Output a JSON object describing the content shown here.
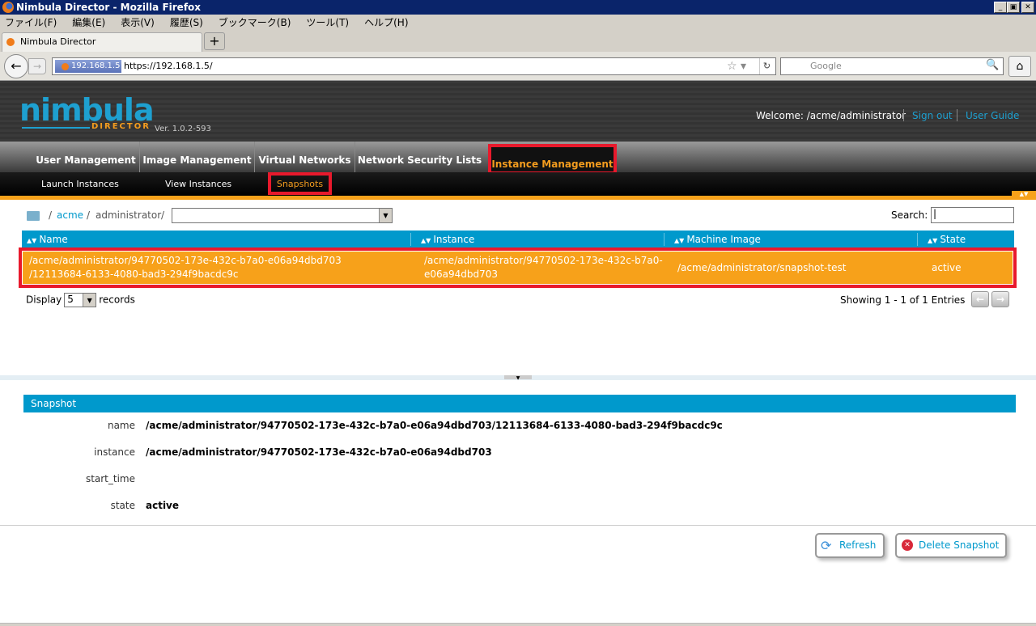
{
  "window": {
    "title": "Nimbula Director - Mozilla Firefox"
  },
  "menu": [
    "ファイル(F)",
    "編集(E)",
    "表示(V)",
    "履歴(S)",
    "ブックマーク(B)",
    "ツール(T)",
    "ヘルプ(H)"
  ],
  "tab": {
    "label": "Nimbula Director",
    "new_tab": "+"
  },
  "urlbar": {
    "identity": "192.168.1.5",
    "url": "https://192.168.1.5/",
    "search_placeholder": "Google"
  },
  "header": {
    "logo": "nimbula",
    "logo_sub": "DIRECTOR",
    "version": "Ver. 1.0.2-593",
    "welcome": "Welcome: /acme/administrator",
    "sign_out": "Sign out",
    "user_guide": "User Guide"
  },
  "nav": {
    "items": [
      "User Management",
      "Image Management",
      "Virtual Networks",
      "Network Security Lists"
    ],
    "active": "Instance Management"
  },
  "subnav": {
    "items": [
      "Launch Instances",
      "View Instances"
    ],
    "active": "Snapshots"
  },
  "breadcrumb": {
    "sep": "/",
    "acme": "acme",
    "administrator": "administrator"
  },
  "search": {
    "label": "Search:",
    "value": "|"
  },
  "table": {
    "columns": [
      "Name",
      "Instance",
      "Machine Image",
      "State"
    ],
    "rows": [
      {
        "name_l1": "/acme/administrator/94770502-173e-432c-b7a0-e06a94dbd703",
        "name_l2": "/12113684-6133-4080-bad3-294f9bacdc9c",
        "inst_l1": "/acme/administrator/94770502-173e-432c-b7a0-",
        "inst_l2": "e06a94dbd703",
        "image": "/acme/administrator/snapshot-test",
        "state": "active"
      }
    ],
    "display_label": "Display",
    "display_value": "5",
    "records_label": "records",
    "showing": "Showing 1 - 1 of 1 Entries"
  },
  "panel": {
    "title": "Snapshot",
    "fields": [
      {
        "label": "name",
        "value": "/acme/administrator/94770502-173e-432c-b7a0-e06a94dbd703/12113684-6133-4080-bad3-294f9bacdc9c"
      },
      {
        "label": "instance",
        "value": "/acme/administrator/94770502-173e-432c-b7a0-e06a94dbd703"
      },
      {
        "label": "start_time",
        "value": ""
      },
      {
        "label": "state",
        "value": "active"
      }
    ]
  },
  "buttons": {
    "refresh": "Refresh",
    "delete": "Delete Snapshot"
  }
}
